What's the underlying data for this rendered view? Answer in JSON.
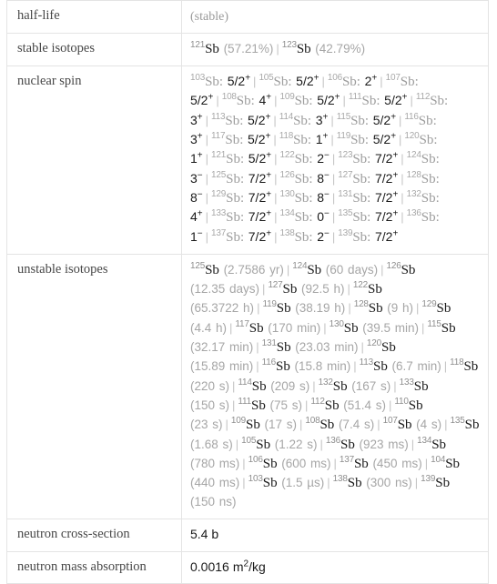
{
  "table": {
    "rows": [
      {
        "label": "half-life",
        "type": "muted_text",
        "key": "half_life"
      },
      {
        "label": "stable isotopes",
        "type": "isotope_list",
        "key": "stable_isotopes"
      },
      {
        "label": "nuclear spin",
        "type": "spin_list",
        "key": "nuclear_spin"
      },
      {
        "label": "unstable isotopes",
        "type": "isotope_list",
        "key": "unstable_isotopes"
      },
      {
        "label": "neutron cross-section",
        "type": "value_text",
        "key": "neutron_cross_section"
      },
      {
        "label": "neutron mass absorption",
        "type": "value_unit",
        "key": "neutron_mass_absorption"
      }
    ]
  },
  "half_life": "(stable)",
  "stable_isotopes": [
    {
      "mass": "121",
      "element": "Sb",
      "value": "(57.21%)"
    },
    {
      "mass": "123",
      "element": "Sb",
      "value": "(42.79%)"
    }
  ],
  "nuclear_spin": [
    {
      "mass": "103",
      "element": "Sb:",
      "spin": "5/2",
      "sign": "+"
    },
    {
      "mass": "105",
      "element": "Sb:",
      "spin": "5/2",
      "sign": "+"
    },
    {
      "mass": "106",
      "element": "Sb:",
      "spin": "2",
      "sign": "+"
    },
    {
      "mass": "107",
      "element": "Sb:",
      "spin": "5/2",
      "sign": "+"
    },
    {
      "mass": "108",
      "element": "Sb:",
      "spin": "4",
      "sign": "+"
    },
    {
      "mass": "109",
      "element": "Sb:",
      "spin": "5/2",
      "sign": "+"
    },
    {
      "mass": "111",
      "element": "Sb:",
      "spin": "5/2",
      "sign": "+"
    },
    {
      "mass": "112",
      "element": "Sb:",
      "spin": "3",
      "sign": "+"
    },
    {
      "mass": "113",
      "element": "Sb:",
      "spin": "5/2",
      "sign": "+"
    },
    {
      "mass": "114",
      "element": "Sb:",
      "spin": "3",
      "sign": "+"
    },
    {
      "mass": "115",
      "element": "Sb:",
      "spin": "5/2",
      "sign": "+"
    },
    {
      "mass": "116",
      "element": "Sb:",
      "spin": "3",
      "sign": "+"
    },
    {
      "mass": "117",
      "element": "Sb:",
      "spin": "5/2",
      "sign": "+"
    },
    {
      "mass": "118",
      "element": "Sb:",
      "spin": "1",
      "sign": "+"
    },
    {
      "mass": "119",
      "element": "Sb:",
      "spin": "5/2",
      "sign": "+"
    },
    {
      "mass": "120",
      "element": "Sb:",
      "spin": "1",
      "sign": "+"
    },
    {
      "mass": "121",
      "element": "Sb:",
      "spin": "5/2",
      "sign": "+"
    },
    {
      "mass": "122",
      "element": "Sb:",
      "spin": "2",
      "sign": "−"
    },
    {
      "mass": "123",
      "element": "Sb:",
      "spin": "7/2",
      "sign": "+"
    },
    {
      "mass": "124",
      "element": "Sb:",
      "spin": "3",
      "sign": "−"
    },
    {
      "mass": "125",
      "element": "Sb:",
      "spin": "7/2",
      "sign": "+"
    },
    {
      "mass": "126",
      "element": "Sb:",
      "spin": "8",
      "sign": "−"
    },
    {
      "mass": "127",
      "element": "Sb:",
      "spin": "7/2",
      "sign": "+"
    },
    {
      "mass": "128",
      "element": "Sb:",
      "spin": "8",
      "sign": "−"
    },
    {
      "mass": "129",
      "element": "Sb:",
      "spin": "7/2",
      "sign": "+"
    },
    {
      "mass": "130",
      "element": "Sb:",
      "spin": "8",
      "sign": "−"
    },
    {
      "mass": "131",
      "element": "Sb:",
      "spin": "7/2",
      "sign": "+"
    },
    {
      "mass": "132",
      "element": "Sb:",
      "spin": "4",
      "sign": "+"
    },
    {
      "mass": "133",
      "element": "Sb:",
      "spin": "7/2",
      "sign": "+"
    },
    {
      "mass": "134",
      "element": "Sb:",
      "spin": "0",
      "sign": "−"
    },
    {
      "mass": "135",
      "element": "Sb:",
      "spin": "7/2",
      "sign": "+"
    },
    {
      "mass": "136",
      "element": "Sb:",
      "spin": "1",
      "sign": "−"
    },
    {
      "mass": "137",
      "element": "Sb:",
      "spin": "7/2",
      "sign": "+"
    },
    {
      "mass": "138",
      "element": "Sb:",
      "spin": "2",
      "sign": "−"
    },
    {
      "mass": "139",
      "element": "Sb:",
      "spin": "7/2",
      "sign": "+"
    }
  ],
  "unstable_isotopes": [
    {
      "mass": "125",
      "element": "Sb",
      "value": "(2.7586 yr)"
    },
    {
      "mass": "124",
      "element": "Sb",
      "value": "(60 days)"
    },
    {
      "mass": "126",
      "element": "Sb",
      "value": "(12.35 days)"
    },
    {
      "mass": "127",
      "element": "Sb",
      "value": "(92.5 h)"
    },
    {
      "mass": "122",
      "element": "Sb",
      "value": "(65.3722 h)"
    },
    {
      "mass": "119",
      "element": "Sb",
      "value": "(38.19 h)"
    },
    {
      "mass": "128",
      "element": "Sb",
      "value": "(9 h)"
    },
    {
      "mass": "129",
      "element": "Sb",
      "value": "(4.4 h)"
    },
    {
      "mass": "117",
      "element": "Sb",
      "value": "(170 min)"
    },
    {
      "mass": "130",
      "element": "Sb",
      "value": "(39.5 min)"
    },
    {
      "mass": "115",
      "element": "Sb",
      "value": "(32.17 min)"
    },
    {
      "mass": "131",
      "element": "Sb",
      "value": "(23.03 min)"
    },
    {
      "mass": "120",
      "element": "Sb",
      "value": "(15.89 min)"
    },
    {
      "mass": "116",
      "element": "Sb",
      "value": "(15.8 min)"
    },
    {
      "mass": "113",
      "element": "Sb",
      "value": "(6.7 min)"
    },
    {
      "mass": "118",
      "element": "Sb",
      "value": "(220 s)"
    },
    {
      "mass": "114",
      "element": "Sb",
      "value": "(209 s)"
    },
    {
      "mass": "132",
      "element": "Sb",
      "value": "(167 s)"
    },
    {
      "mass": "133",
      "element": "Sb",
      "value": "(150 s)"
    },
    {
      "mass": "111",
      "element": "Sb",
      "value": "(75 s)"
    },
    {
      "mass": "112",
      "element": "Sb",
      "value": "(51.4 s)"
    },
    {
      "mass": "110",
      "element": "Sb",
      "value": "(23 s)"
    },
    {
      "mass": "109",
      "element": "Sb",
      "value": "(17 s)"
    },
    {
      "mass": "108",
      "element": "Sb",
      "value": "(7.4 s)"
    },
    {
      "mass": "107",
      "element": "Sb",
      "value": "(4 s)"
    },
    {
      "mass": "135",
      "element": "Sb",
      "value": "(1.68 s)"
    },
    {
      "mass": "105",
      "element": "Sb",
      "value": "(1.22 s)"
    },
    {
      "mass": "136",
      "element": "Sb",
      "value": "(923 ms)"
    },
    {
      "mass": "134",
      "element": "Sb",
      "value": "(780 ms)"
    },
    {
      "mass": "106",
      "element": "Sb",
      "value": "(600 ms)"
    },
    {
      "mass": "137",
      "element": "Sb",
      "value": "(450 ms)"
    },
    {
      "mass": "104",
      "element": "Sb",
      "value": "(440 ms)"
    },
    {
      "mass": "103",
      "element": "Sb",
      "value": "(1.5 µs)"
    },
    {
      "mass": "138",
      "element": "Sb",
      "value": "(300 ns)"
    },
    {
      "mass": "139",
      "element": "Sb",
      "value": "(150 ns)"
    }
  ],
  "neutron_cross_section": "5.4 b",
  "neutron_mass_absorption": {
    "number": "0.0016",
    "unit": "m",
    "exponent": "2",
    "per": "/kg"
  },
  "separator": "|",
  "colors": {
    "border": "#e4e4e4",
    "label_text": "#474747",
    "muted_text": "#9a9a9a",
    "value_text": "#1a1a1a"
  }
}
